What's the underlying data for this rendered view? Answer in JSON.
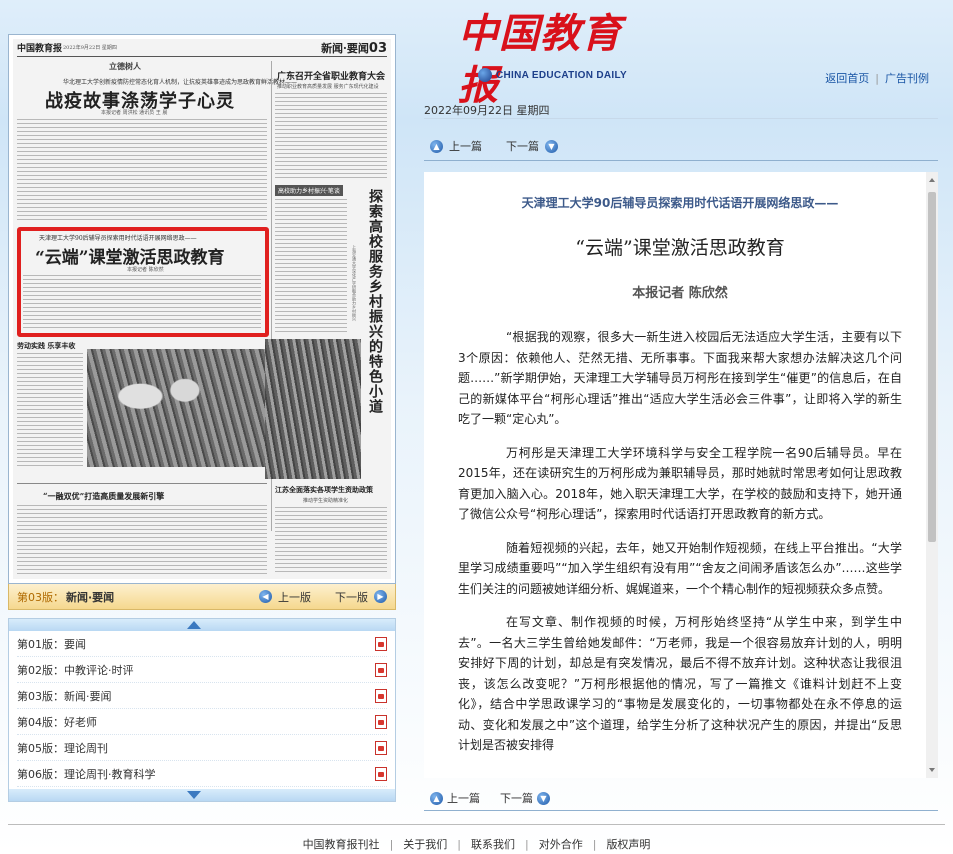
{
  "header": {
    "logo_cn": "中国教育报",
    "logo_en": "CHINA EDUCATION DAILY",
    "links": [
      "返回首页",
      "广告刊例"
    ]
  },
  "paper": {
    "masthead": "中国教育报",
    "date_line": "2022年9月22日 星期四",
    "section_label": "新闻·要闻",
    "section_num": "03",
    "kicker": "立德树人",
    "story1_sub": "华北理工大学创新疫情防控常态化育人机制，让抗疫英雄事迹成为思政教育鲜活教材——",
    "story1_title": "战疫故事涤荡学子心灵",
    "story1_byline": "本报记者 周洪松 通讯员 王 晨",
    "right_title": "广东召开全省职业教育大会",
    "right_byline": "推动职业教育高质量发展 服务广东现代化建设",
    "vertical_title": "探索高校服务乡村振兴的特色小道",
    "vertical_side": "上海交通大学深化产学研融合助力乡村振兴",
    "box_title": "高校助力乡村振兴·笔谈",
    "story2_sub": "天津理工大学90后辅导员探索用时代话语开展网络思政——",
    "story2_title": "“云端”课堂激活思政教育",
    "story2_byline": "本报记者 陈欣然",
    "photo_caption": "劳动实践 乐享丰收",
    "story3_title": "“一融双优”打造高质量发展新引擎",
    "right_title2": "江苏全面落实各项学生资助政策",
    "right_sub2": "推动学生资助精准化"
  },
  "page_nav": {
    "label": "第03版：",
    "name": "新闻·要闻",
    "prev": "上一版",
    "next": "下一版"
  },
  "page_list": [
    {
      "label": "第01版：要闻"
    },
    {
      "label": "第02版：中教评论·时评"
    },
    {
      "label": "第03版：新闻·要闻"
    },
    {
      "label": "第04版：好老师"
    },
    {
      "label": "第05版：理论周刊"
    },
    {
      "label": "第06版：理论周刊·教育科学"
    }
  ],
  "date": "2022年09月22日 星期四",
  "article_nav": {
    "prev": "上一篇",
    "next": "下一篇"
  },
  "article": {
    "subtitle": "天津理工大学90后辅导员探索用时代话语开展网络思政——",
    "title": "“云端”课堂激活思政教育",
    "author": "本报记者 陈欣然",
    "paragraphs": [
      "“根据我的观察，很多大一新生进入校园后无法适应大学生活，主要有以下3个原因：依赖他人、茫然无措、无所事事。下面我来帮大家想办法解决这几个问题……”新学期伊始，天津理工大学辅导员万柯彤在接到学生“催更”的信息后，在自己的新媒体平台“柯彤心理话”推出“适应大学生活必会三件事”，让即将入学的新生吃了一颗“定心丸”。",
      "万柯彤是天津理工大学环境科学与安全工程学院一名90后辅导员。早在2015年，还在读研究生的万柯彤成为兼职辅导员，那时她就时常思考如何让思政教育更加入脑入心。2018年，她入职天津理工大学，在学校的鼓励和支持下，她开通了微信公众号“柯彤心理话”，探索用时代话语打开思政教育的新方式。",
      "随着短视频的兴起，去年，她又开始制作短视频，在线上平台推出。“大学里学习成绩重要吗”“加入学生组织有没有用”“舍友之间闹矛盾该怎么办”……这些学生们关注的问题被她详细分析、娓娓道来，一个个精心制作的短视频获众多点赞。",
      "在写文章、制作视频的时候，万柯彤始终坚持“从学生中来，到学生中去”。一名大三学生曾给她发邮件：“万老师，我是一个很容易放弃计划的人，明明安排好下周的计划，却总是有突发情况，最后不得不放弃计划。这种状态让我很沮丧，该怎么改变呢？”万柯彤根据他的情况，写了一篇推文《谁料计划赶不上变化》，结合中学思政课学习的“事物是发展变化的，一切事物都处在永不停息的运动、变化和发展之中”这个道理，给学生分析了这种状况产生的原因，并提出“反思计划是否被安排得"
    ]
  },
  "footer": {
    "links": [
      "中国教育报刊社",
      "关于我们",
      "联系我们",
      "对外合作",
      "版权声明"
    ]
  },
  "colors": {
    "logo_red": "#d9111b",
    "highlight_red": "#e0201f",
    "nav_blue": "#1f5aa8",
    "page_nav_bg": "#f5d88e"
  }
}
